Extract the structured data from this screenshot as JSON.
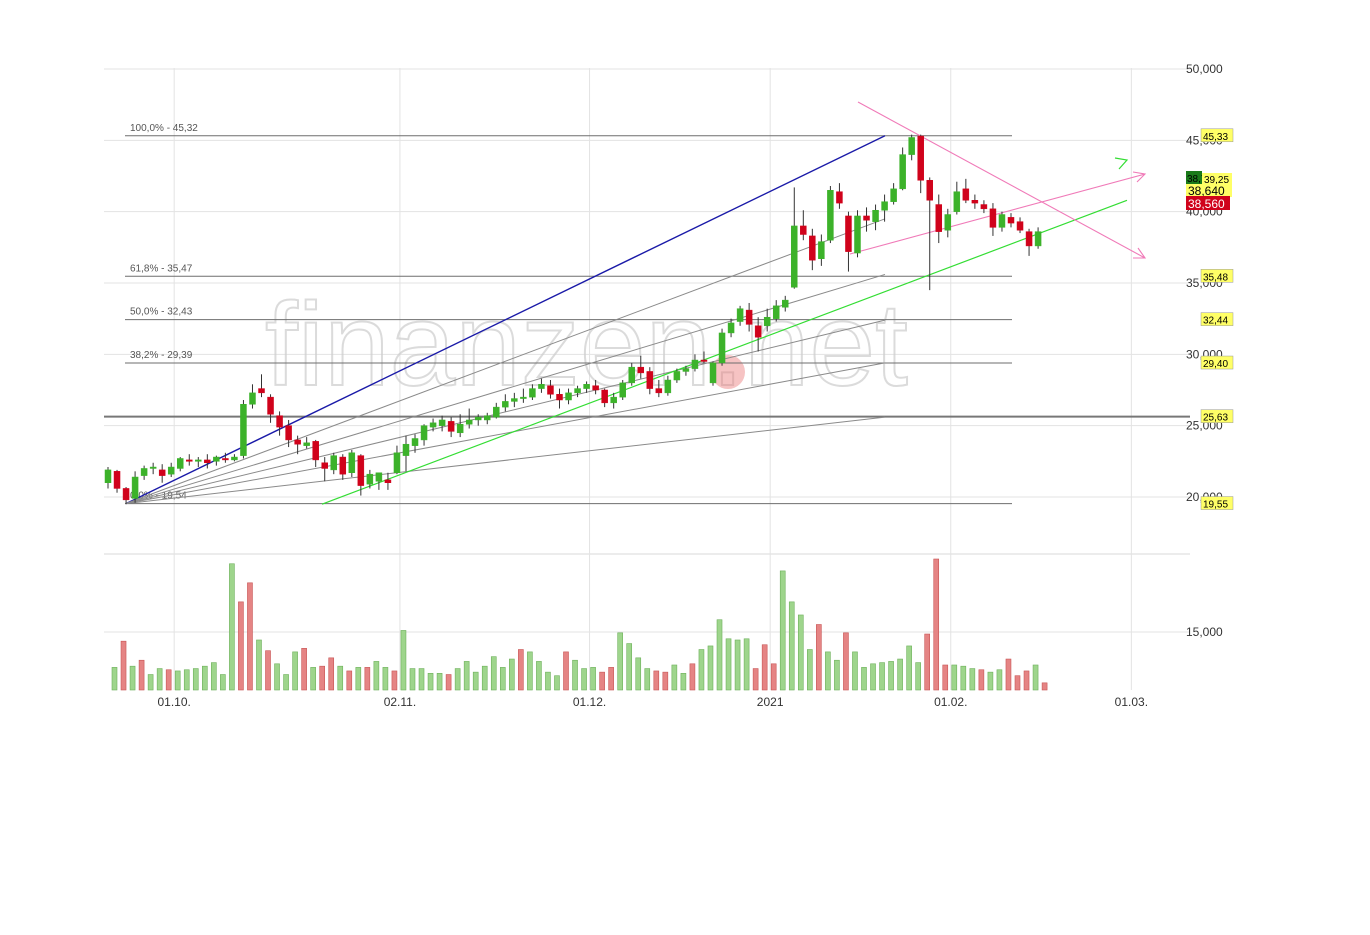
{
  "colors": {
    "up": "#3cb22a",
    "down": "#d0021b",
    "vol_up": "#9ed58c",
    "vol_down": "#e58484",
    "grid": "#e3e3e3",
    "tag_bg": "#ffff66"
  },
  "watermark": "finanzen.net",
  "chart_data": {
    "type": "candlestick",
    "title": "",
    "price_axis": {
      "min": 17000,
      "max": 50000,
      "ticks": [
        "50,000",
        "45,000",
        "40,000",
        "35,000",
        "30,000",
        "25,000",
        "20,000"
      ],
      "tick_values": [
        50000,
        45000,
        40000,
        35000,
        30000,
        25000,
        20000
      ]
    },
    "volume_axis": {
      "ticks": [
        "15,000"
      ]
    },
    "x_axis": {
      "ticks": [
        "01.10.",
        "02.11.",
        "01.12.",
        "2021",
        "01.02.",
        "01.03."
      ],
      "tick_index": [
        6,
        31,
        52,
        72,
        92,
        112
      ]
    },
    "fibonacci": [
      {
        "label": "100,0% - 45,32",
        "value": 45.32,
        "tag": "45,33"
      },
      {
        "label": "61,8% - 35,47",
        "value": 35.47,
        "tag": "35,48"
      },
      {
        "label": "50,0% - 32,43",
        "value": 32.43,
        "tag": "32,44"
      },
      {
        "label": "38,2% - 29,39",
        "value": 29.39,
        "tag": "29,40"
      },
      {
        "label": "0,0% - 19,54",
        "value": 19.54,
        "tag": "19,55"
      }
    ],
    "horizontal_line": {
      "value": 25.63,
      "tag": "25,63"
    },
    "price_tags": [
      {
        "text": "38,7",
        "value": 39.6,
        "color": "#1a7a1a",
        "textcolor": "#ffffff"
      },
      {
        "text": "39,25",
        "value": 39.65,
        "color": "#ffff66",
        "textcolor": "#000000"
      },
      {
        "text": "38,640",
        "value": 38.64,
        "color": "#ffff66",
        "textcolor": "#000000"
      },
      {
        "text": "38,560",
        "value": 38.0,
        "color": "#d0021b",
        "textcolor": "#ffffff"
      }
    ],
    "candles": [
      [
        21.0,
        22.1,
        20.6,
        21.9
      ],
      [
        21.8,
        21.9,
        20.3,
        20.6
      ],
      [
        20.6,
        20.7,
        19.5,
        19.8
      ],
      [
        19.9,
        21.8,
        19.6,
        21.4
      ],
      [
        21.5,
        22.2,
        21.2,
        22.0
      ],
      [
        22.0,
        22.4,
        21.6,
        22.1
      ],
      [
        21.9,
        22.3,
        21.0,
        21.5
      ],
      [
        21.6,
        22.4,
        21.4,
        22.1
      ],
      [
        22.0,
        22.8,
        21.8,
        22.7
      ],
      [
        22.6,
        23.0,
        22.2,
        22.5
      ],
      [
        22.5,
        22.8,
        22.1,
        22.6
      ],
      [
        22.6,
        23.0,
        22.0,
        22.4
      ],
      [
        22.5,
        22.9,
        22.2,
        22.8
      ],
      [
        22.7,
        23.1,
        22.4,
        22.6
      ],
      [
        22.6,
        23.0,
        22.5,
        22.8
      ],
      [
        22.9,
        26.8,
        22.7,
        26.5
      ],
      [
        26.5,
        27.9,
        26.2,
        27.3
      ],
      [
        27.6,
        28.6,
        27.0,
        27.3
      ],
      [
        27.0,
        27.2,
        25.2,
        25.8
      ],
      [
        25.7,
        26.0,
        24.3,
        24.9
      ],
      [
        25.0,
        25.4,
        23.5,
        24.0
      ],
      [
        24.0,
        24.3,
        23.0,
        23.7
      ],
      [
        23.6,
        24.2,
        23.4,
        23.8
      ],
      [
        23.9,
        24.0,
        22.1,
        22.6
      ],
      [
        22.4,
        22.8,
        21.1,
        22.0
      ],
      [
        21.9,
        23.1,
        21.6,
        22.9
      ],
      [
        22.8,
        23.0,
        21.2,
        21.6
      ],
      [
        21.7,
        23.3,
        21.4,
        23.1
      ],
      [
        22.9,
        23.0,
        20.1,
        20.8
      ],
      [
        20.9,
        21.9,
        20.6,
        21.6
      ],
      [
        21.1,
        21.7,
        20.5,
        21.7
      ],
      [
        21.2,
        21.7,
        20.5,
        21.0
      ],
      [
        21.7,
        23.6,
        21.6,
        23.1
      ],
      [
        22.9,
        24.3,
        21.8,
        23.7
      ],
      [
        23.6,
        24.4,
        23.1,
        24.1
      ],
      [
        24.0,
        25.1,
        23.6,
        25.0
      ],
      [
        24.9,
        25.5,
        24.6,
        25.2
      ],
      [
        25.0,
        25.7,
        24.6,
        25.4
      ],
      [
        25.3,
        25.6,
        24.2,
        24.6
      ],
      [
        24.5,
        25.8,
        24.2,
        25.1
      ],
      [
        25.1,
        26.2,
        24.8,
        25.4
      ],
      [
        25.4,
        25.8,
        25.0,
        25.6
      ],
      [
        25.4,
        25.9,
        25.1,
        25.7
      ],
      [
        25.6,
        26.6,
        25.5,
        26.3
      ],
      [
        26.3,
        27.2,
        26.0,
        26.7
      ],
      [
        26.7,
        27.3,
        26.3,
        26.9
      ],
      [
        26.9,
        27.6,
        26.6,
        27.0
      ],
      [
        27.0,
        27.9,
        26.8,
        27.6
      ],
      [
        27.6,
        28.3,
        27.3,
        27.9
      ],
      [
        27.8,
        28.2,
        26.9,
        27.2
      ],
      [
        27.2,
        27.6,
        26.2,
        26.8
      ],
      [
        26.8,
        27.6,
        26.5,
        27.3
      ],
      [
        27.3,
        27.8,
        27.0,
        27.6
      ],
      [
        27.6,
        28.1,
        27.3,
        27.9
      ],
      [
        27.8,
        28.2,
        27.2,
        27.5
      ],
      [
        27.5,
        27.6,
        26.3,
        26.6
      ],
      [
        26.6,
        27.3,
        26.2,
        27.0
      ],
      [
        27.0,
        28.2,
        26.8,
        28.0
      ],
      [
        28.0,
        29.4,
        27.8,
        29.1
      ],
      [
        29.1,
        29.9,
        28.3,
        28.7
      ],
      [
        28.8,
        29.1,
        27.2,
        27.6
      ],
      [
        27.6,
        28.2,
        27.0,
        27.3
      ],
      [
        27.3,
        28.5,
        27.1,
        28.2
      ],
      [
        28.2,
        29.0,
        28.0,
        28.8
      ],
      [
        28.8,
        29.2,
        28.5,
        29.0
      ],
      [
        29.0,
        30.0,
        28.8,
        29.6
      ],
      [
        29.6,
        30.2,
        29.4,
        29.5
      ],
      [
        28.0,
        29.5,
        27.8,
        29.4
      ],
      [
        29.4,
        31.8,
        29.2,
        31.5
      ],
      [
        31.5,
        32.5,
        31.2,
        32.2
      ],
      [
        32.3,
        33.4,
        32.0,
        33.2
      ],
      [
        33.1,
        33.6,
        31.6,
        32.1
      ],
      [
        32.0,
        32.6,
        30.2,
        31.2
      ],
      [
        32.0,
        33.2,
        31.6,
        32.6
      ],
      [
        32.5,
        33.8,
        32.3,
        33.4
      ],
      [
        33.3,
        34.1,
        33.0,
        33.8
      ],
      [
        34.7,
        41.7,
        34.6,
        39.0
      ],
      [
        39.0,
        40.1,
        38.0,
        38.4
      ],
      [
        38.3,
        38.8,
        35.9,
        36.6
      ],
      [
        36.7,
        38.4,
        36.2,
        37.9
      ],
      [
        38.0,
        41.8,
        37.8,
        41.5
      ],
      [
        41.4,
        42.0,
        40.2,
        40.6
      ],
      [
        39.7,
        40.0,
        35.8,
        37.2
      ],
      [
        37.1,
        40.1,
        36.8,
        39.7
      ],
      [
        39.7,
        40.3,
        38.6,
        39.4
      ],
      [
        39.3,
        40.5,
        38.7,
        40.1
      ],
      [
        40.1,
        41.2,
        39.3,
        40.7
      ],
      [
        40.7,
        42.0,
        40.5,
        41.6
      ],
      [
        41.6,
        44.5,
        41.5,
        44.0
      ],
      [
        44.0,
        45.4,
        43.6,
        45.2
      ],
      [
        45.3,
        45.4,
        41.3,
        42.2
      ],
      [
        42.2,
        42.4,
        34.5,
        40.8
      ],
      [
        40.5,
        41.2,
        37.8,
        38.6
      ],
      [
        38.7,
        40.2,
        38.2,
        39.8
      ],
      [
        40.0,
        42.1,
        39.8,
        41.4
      ],
      [
        41.6,
        42.3,
        40.6,
        40.8
      ],
      [
        40.8,
        41.2,
        40.2,
        40.6
      ],
      [
        40.5,
        40.8,
        39.9,
        40.2
      ],
      [
        40.2,
        40.6,
        38.3,
        38.9
      ],
      [
        38.9,
        40.0,
        38.6,
        39.8
      ],
      [
        39.6,
        39.9,
        38.9,
        39.2
      ],
      [
        39.3,
        39.6,
        38.5,
        38.7
      ],
      [
        38.6,
        38.8,
        36.9,
        37.6
      ],
      [
        37.6,
        38.9,
        37.4,
        38.6
      ]
    ],
    "volumes": [
      1.9,
      4.1,
      2.0,
      2.5,
      1.3,
      1.8,
      1.7,
      1.6,
      1.7,
      1.8,
      2.0,
      2.3,
      1.3,
      10.6,
      7.4,
      9.0,
      4.2,
      3.3,
      2.2,
      1.3,
      3.2,
      3.5,
      1.9,
      2.0,
      2.7,
      2.0,
      1.6,
      1.9,
      1.9,
      2.4,
      1.9,
      1.6,
      5.0,
      1.8,
      1.8,
      1.4,
      1.4,
      1.3,
      1.8,
      2.4,
      1.5,
      2.0,
      2.8,
      1.9,
      2.6,
      3.4,
      3.2,
      2.4,
      1.5,
      1.2,
      3.2,
      2.5,
      1.8,
      1.9,
      1.5,
      1.9,
      4.8,
      3.9,
      2.7,
      1.8,
      1.6,
      1.5,
      2.1,
      1.4,
      2.2,
      3.4,
      3.7,
      5.9,
      4.3,
      4.2,
      4.3,
      1.8,
      3.8,
      2.2,
      10.0,
      7.4,
      6.3,
      3.4,
      5.5,
      3.2,
      2.5,
      4.8,
      3.2,
      1.9,
      2.2,
      2.3,
      2.4,
      2.6,
      3.7,
      2.3,
      4.7,
      11.0,
      2.1,
      2.1,
      2.0,
      1.8,
      1.7,
      1.5,
      1.7,
      2.6,
      1.2,
      1.6,
      2.1,
      0.6
    ],
    "volume_colors_down_index": [
      1,
      3,
      6,
      14,
      15,
      17,
      21,
      23,
      24,
      26,
      28,
      31,
      37,
      45,
      50,
      54,
      55,
      60,
      61,
      64,
      71,
      72,
      73,
      78,
      81,
      90,
      91,
      92,
      96,
      99,
      100,
      101,
      103,
      104
    ],
    "annotations": []
  }
}
